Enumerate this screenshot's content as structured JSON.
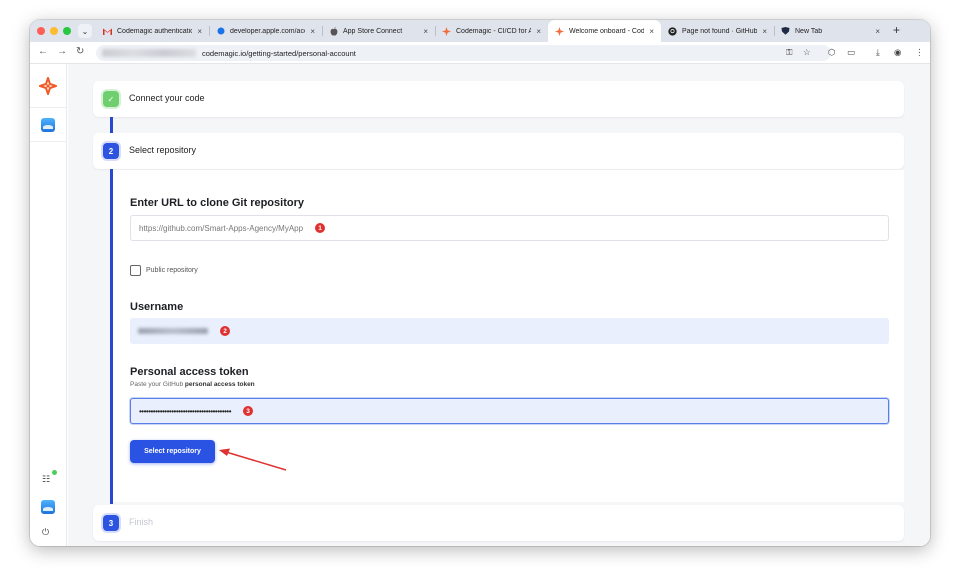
{
  "browser": {
    "tabs": [
      {
        "title": "Codemagic authentication",
        "icon": "gmail-icon",
        "active": false
      },
      {
        "title": "developer.apple.com/account",
        "icon": "apple-dev-icon",
        "active": false
      },
      {
        "title": "App Store Connect",
        "icon": "apple-icon",
        "active": false
      },
      {
        "title": "Codemagic - CI/CD for Android",
        "icon": "codemagic-icon",
        "active": false
      },
      {
        "title": "Welcome onboard - Codemagic",
        "icon": "codemagic-icon",
        "active": true
      },
      {
        "title": "Page not found · GitHub",
        "icon": "github-icon",
        "active": false
      },
      {
        "title": "New Tab",
        "icon": "new-tab-icon",
        "active": false
      }
    ],
    "close_glyph": "×",
    "new_tab_glyph": "+",
    "url": "codemagic.io/getting-started/personal-account"
  },
  "steps": {
    "connect": {
      "number": "✓",
      "title": "Connect your code"
    },
    "select": {
      "number": "2",
      "title": "Select repository"
    },
    "finish": {
      "number": "3",
      "title": "Finish"
    }
  },
  "form": {
    "url_label": "Enter URL to clone Git repository",
    "url_placeholder": "https://github.com/Smart-Apps-Agency/MyApp",
    "public_label": "Public repository",
    "username_label": "Username",
    "token_label": "Personal access token",
    "token_hint_prefix": "Paste your GitHub ",
    "token_hint_bold": "personal access token",
    "token_value": "••••••••••••••••••••••••••••••••••••••••",
    "submit_label": "Select repository"
  },
  "annotations": {
    "m1": "1",
    "m2": "2",
    "m3": "3"
  },
  "colors": {
    "accent": "#2a52e3",
    "marker": "#e03131",
    "done": "#6fcf6f"
  }
}
